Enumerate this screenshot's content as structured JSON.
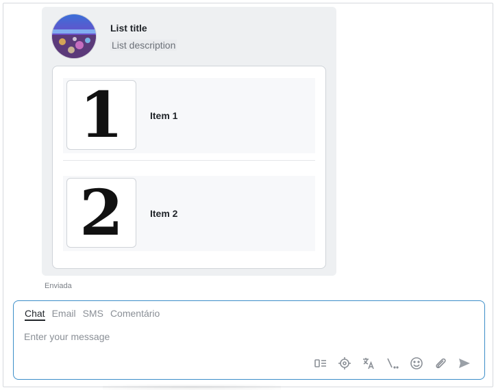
{
  "message": {
    "list_title": "List title",
    "list_description": "List description",
    "items": [
      {
        "digit": "1",
        "label": "Item 1"
      },
      {
        "digit": "2",
        "label": "Item 2"
      }
    ],
    "status": "Enviada"
  },
  "composer": {
    "tabs": [
      {
        "label": "Chat",
        "active": true
      },
      {
        "label": "Email",
        "active": false
      },
      {
        "label": "SMS",
        "active": false
      },
      {
        "label": "Comentário",
        "active": false
      }
    ],
    "placeholder": "Enter your message",
    "toolbar_icons": [
      "layout-list-icon",
      "target-icon",
      "translate-icon",
      "slash-command-icon",
      "emoji-icon",
      "paperclip-icon",
      "send-icon"
    ]
  },
  "colors": {
    "accent_border": "#3a8dc8",
    "bubble_bg": "#eef0f2"
  }
}
